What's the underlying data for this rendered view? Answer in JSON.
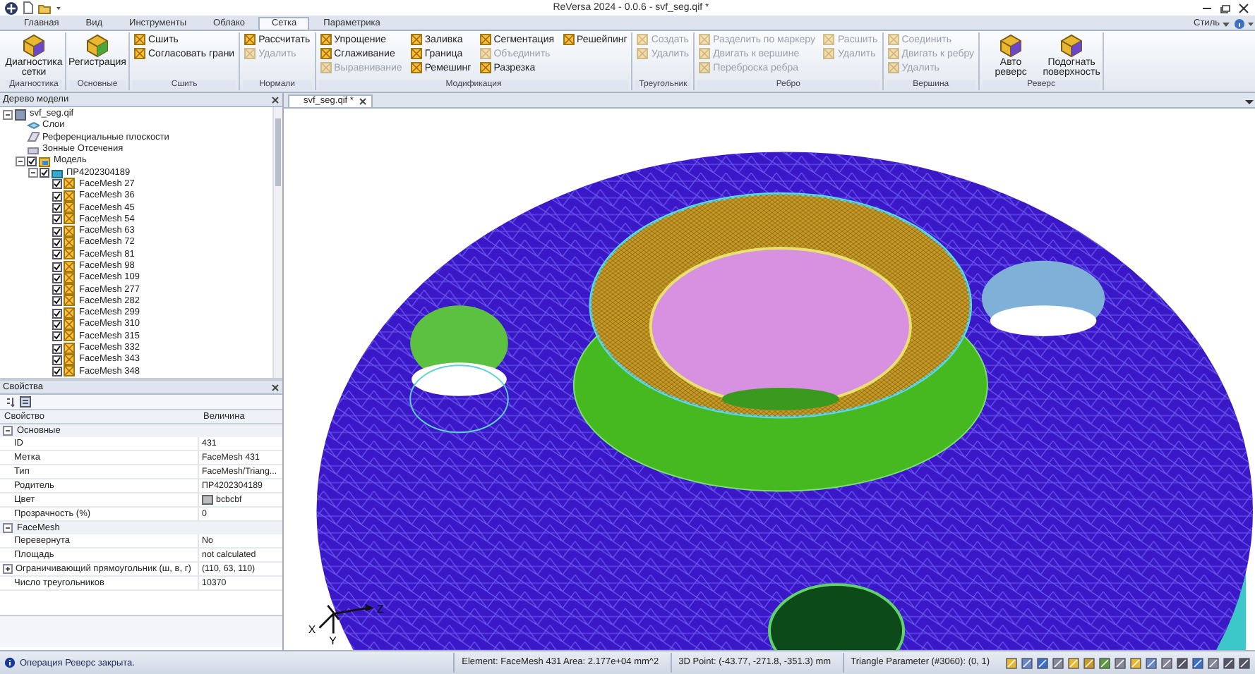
{
  "window": {
    "title": "ReVersa 2024 - 0.0.6 - svf_seg.qif *"
  },
  "ribbon": {
    "tabs": [
      {
        "label": "Главная",
        "selected": false
      },
      {
        "label": "Вид",
        "selected": false
      },
      {
        "label": "Инструменты",
        "selected": false
      },
      {
        "label": "Облако",
        "selected": false
      },
      {
        "label": "Сетка",
        "selected": true
      },
      {
        "label": "Параметрика",
        "selected": false
      }
    ],
    "style_menu": "Стиль",
    "groups": [
      {
        "label": "Диагностика",
        "buttons": [
          {
            "label": "Диагностика сетки",
            "kind": "large",
            "disabled": false
          }
        ]
      },
      {
        "label": "Основные",
        "buttons": [
          {
            "label": "Регистрация",
            "kind": "large",
            "disabled": false
          }
        ]
      },
      {
        "label": "Сшить",
        "buttons": [
          {
            "label": "Сшить",
            "kind": "small",
            "disabled": false
          },
          {
            "label": "Согласовать грани",
            "kind": "small",
            "disabled": false
          }
        ]
      },
      {
        "label": "Нормали",
        "buttons": [
          {
            "label": "Рассчитать",
            "kind": "small",
            "disabled": false
          },
          {
            "label": "Удалить",
            "kind": "small",
            "disabled": true
          }
        ]
      },
      {
        "label": "Модификация",
        "buttons": [
          {
            "label": "Упрощение",
            "kind": "small",
            "disabled": false
          },
          {
            "label": "Сглаживание",
            "kind": "small",
            "disabled": false
          },
          {
            "label": "Выравнивание",
            "kind": "small",
            "disabled": true
          },
          {
            "label": "Заливка",
            "kind": "small",
            "disabled": false
          },
          {
            "label": "Граница",
            "kind": "small",
            "disabled": false
          },
          {
            "label": "Ремешинг",
            "kind": "small",
            "disabled": false
          },
          {
            "label": "Сегментация",
            "kind": "small",
            "disabled": false
          },
          {
            "label": "Объединить",
            "kind": "small",
            "disabled": true
          },
          {
            "label": "Разрезка",
            "kind": "small",
            "disabled": false
          },
          {
            "label": "Решейпинг",
            "kind": "small",
            "disabled": false
          }
        ]
      },
      {
        "label": "Треугольник",
        "buttons": [
          {
            "label": "Создать",
            "kind": "small",
            "disabled": true
          },
          {
            "label": "Удалить",
            "kind": "small",
            "disabled": true
          }
        ]
      },
      {
        "label": "Ребро",
        "buttons": [
          {
            "label": "Разделить по маркеру",
            "kind": "small",
            "disabled": true
          },
          {
            "label": "Двигать к вершине",
            "kind": "small",
            "disabled": true
          },
          {
            "label": "Переброска ребра",
            "kind": "small",
            "disabled": true
          },
          {
            "label": "Расшить",
            "kind": "small",
            "disabled": true
          },
          {
            "label": "Удалить",
            "kind": "small",
            "disabled": true
          }
        ]
      },
      {
        "label": "Вершина",
        "buttons": [
          {
            "label": "Соединить",
            "kind": "small",
            "disabled": true
          },
          {
            "label": "Двигать к ребру",
            "kind": "small",
            "disabled": true
          },
          {
            "label": "Удалить",
            "kind": "small",
            "disabled": true
          }
        ]
      },
      {
        "label": "Реверс",
        "buttons": [
          {
            "label": "Авто реверс",
            "kind": "large",
            "disabled": false
          },
          {
            "label": "Подогнать поверхность",
            "kind": "large",
            "disabled": false
          }
        ]
      }
    ]
  },
  "model_tree": {
    "title": "Дерево модели",
    "items": [
      {
        "label": "svf_seg.qif",
        "kind": "file",
        "expanded": true,
        "children": [
          {
            "label": "Слои",
            "kind": "layers"
          },
          {
            "label": "Референциальные плоскости",
            "kind": "planes"
          },
          {
            "label": "Зонные Отсечения",
            "kind": "sections"
          },
          {
            "label": "Модель",
            "kind": "model",
            "checked": true,
            "expanded": true,
            "children": [
              {
                "label": "ПР4202304189",
                "kind": "part",
                "checked": true,
                "expanded": true,
                "children": [
                  {
                    "label": "FaceMesh 27",
                    "kind": "facemesh",
                    "checked": true
                  },
                  {
                    "label": "FaceMesh 36",
                    "kind": "facemesh",
                    "checked": true
                  },
                  {
                    "label": "FaceMesh 45",
                    "kind": "facemesh",
                    "checked": true
                  },
                  {
                    "label": "FaceMesh 54",
                    "kind": "facemesh",
                    "checked": true
                  },
                  {
                    "label": "FaceMesh 63",
                    "kind": "facemesh",
                    "checked": true
                  },
                  {
                    "label": "FaceMesh 72",
                    "kind": "facemesh",
                    "checked": true
                  },
                  {
                    "label": "FaceMesh 81",
                    "kind": "facemesh",
                    "checked": true
                  },
                  {
                    "label": "FaceMesh 98",
                    "kind": "facemesh",
                    "checked": true
                  },
                  {
                    "label": "FaceMesh 109",
                    "kind": "facemesh",
                    "checked": true
                  },
                  {
                    "label": "FaceMesh 277",
                    "kind": "facemesh",
                    "checked": true
                  },
                  {
                    "label": "FaceMesh 282",
                    "kind": "facemesh",
                    "checked": true
                  },
                  {
                    "label": "FaceMesh 299",
                    "kind": "facemesh",
                    "checked": true
                  },
                  {
                    "label": "FaceMesh 310",
                    "kind": "facemesh",
                    "checked": true
                  },
                  {
                    "label": "FaceMesh 315",
                    "kind": "facemesh",
                    "checked": true
                  },
                  {
                    "label": "FaceMesh 332",
                    "kind": "facemesh",
                    "checked": true
                  },
                  {
                    "label": "FaceMesh 343",
                    "kind": "facemesh",
                    "checked": true
                  },
                  {
                    "label": "FaceMesh 348",
                    "kind": "facemesh",
                    "checked": true
                  }
                ]
              }
            ]
          }
        ]
      }
    ]
  },
  "properties": {
    "title": "Свойства",
    "columns": [
      "Свойство",
      "Величина"
    ],
    "categories": [
      {
        "label": "Основные",
        "expanded": true,
        "rows": [
          {
            "name": "ID",
            "value": "431",
            "kind": "text"
          },
          {
            "name": "Метка",
            "value": "FaceMesh 431",
            "kind": "text"
          },
          {
            "name": "Тип",
            "value": "FaceMesh/Triang...",
            "kind": "text"
          },
          {
            "name": "Родитель",
            "value": "ПР4202304189",
            "kind": "text"
          },
          {
            "name": "Цвет",
            "value": "bcbcbf",
            "kind": "color",
            "color": "#bcbcbf"
          },
          {
            "name": "Прозрачность (%)",
            "value": "0",
            "kind": "text"
          }
        ]
      },
      {
        "label": "FaceMesh",
        "expanded": true,
        "rows": [
          {
            "name": "Перевернута",
            "value": "No",
            "kind": "text"
          },
          {
            "name": "Площадь",
            "value": "not calculated",
            "kind": "text"
          },
          {
            "name": "Ограничивающий прямоугольник (ш, в, г)",
            "value": "(110, 63, 110)",
            "kind": "expandable",
            "expanded": false
          },
          {
            "name": "Число треугольников",
            "value": "10370",
            "kind": "text"
          }
        ]
      }
    ]
  },
  "document": {
    "tab": "svf_seg.qif *",
    "axes": [
      "X",
      "Y",
      "Z"
    ]
  },
  "status_bar": {
    "message": "Операция Реверс закрыта.",
    "fields": [
      "Element: FaceMesh 431 Area: 2.177e+04 mm^2",
      "3D Point: (-43.77, -271.8, -351.3) mm",
      "Triangle Parameter (#3060): (0, 1)"
    ]
  }
}
